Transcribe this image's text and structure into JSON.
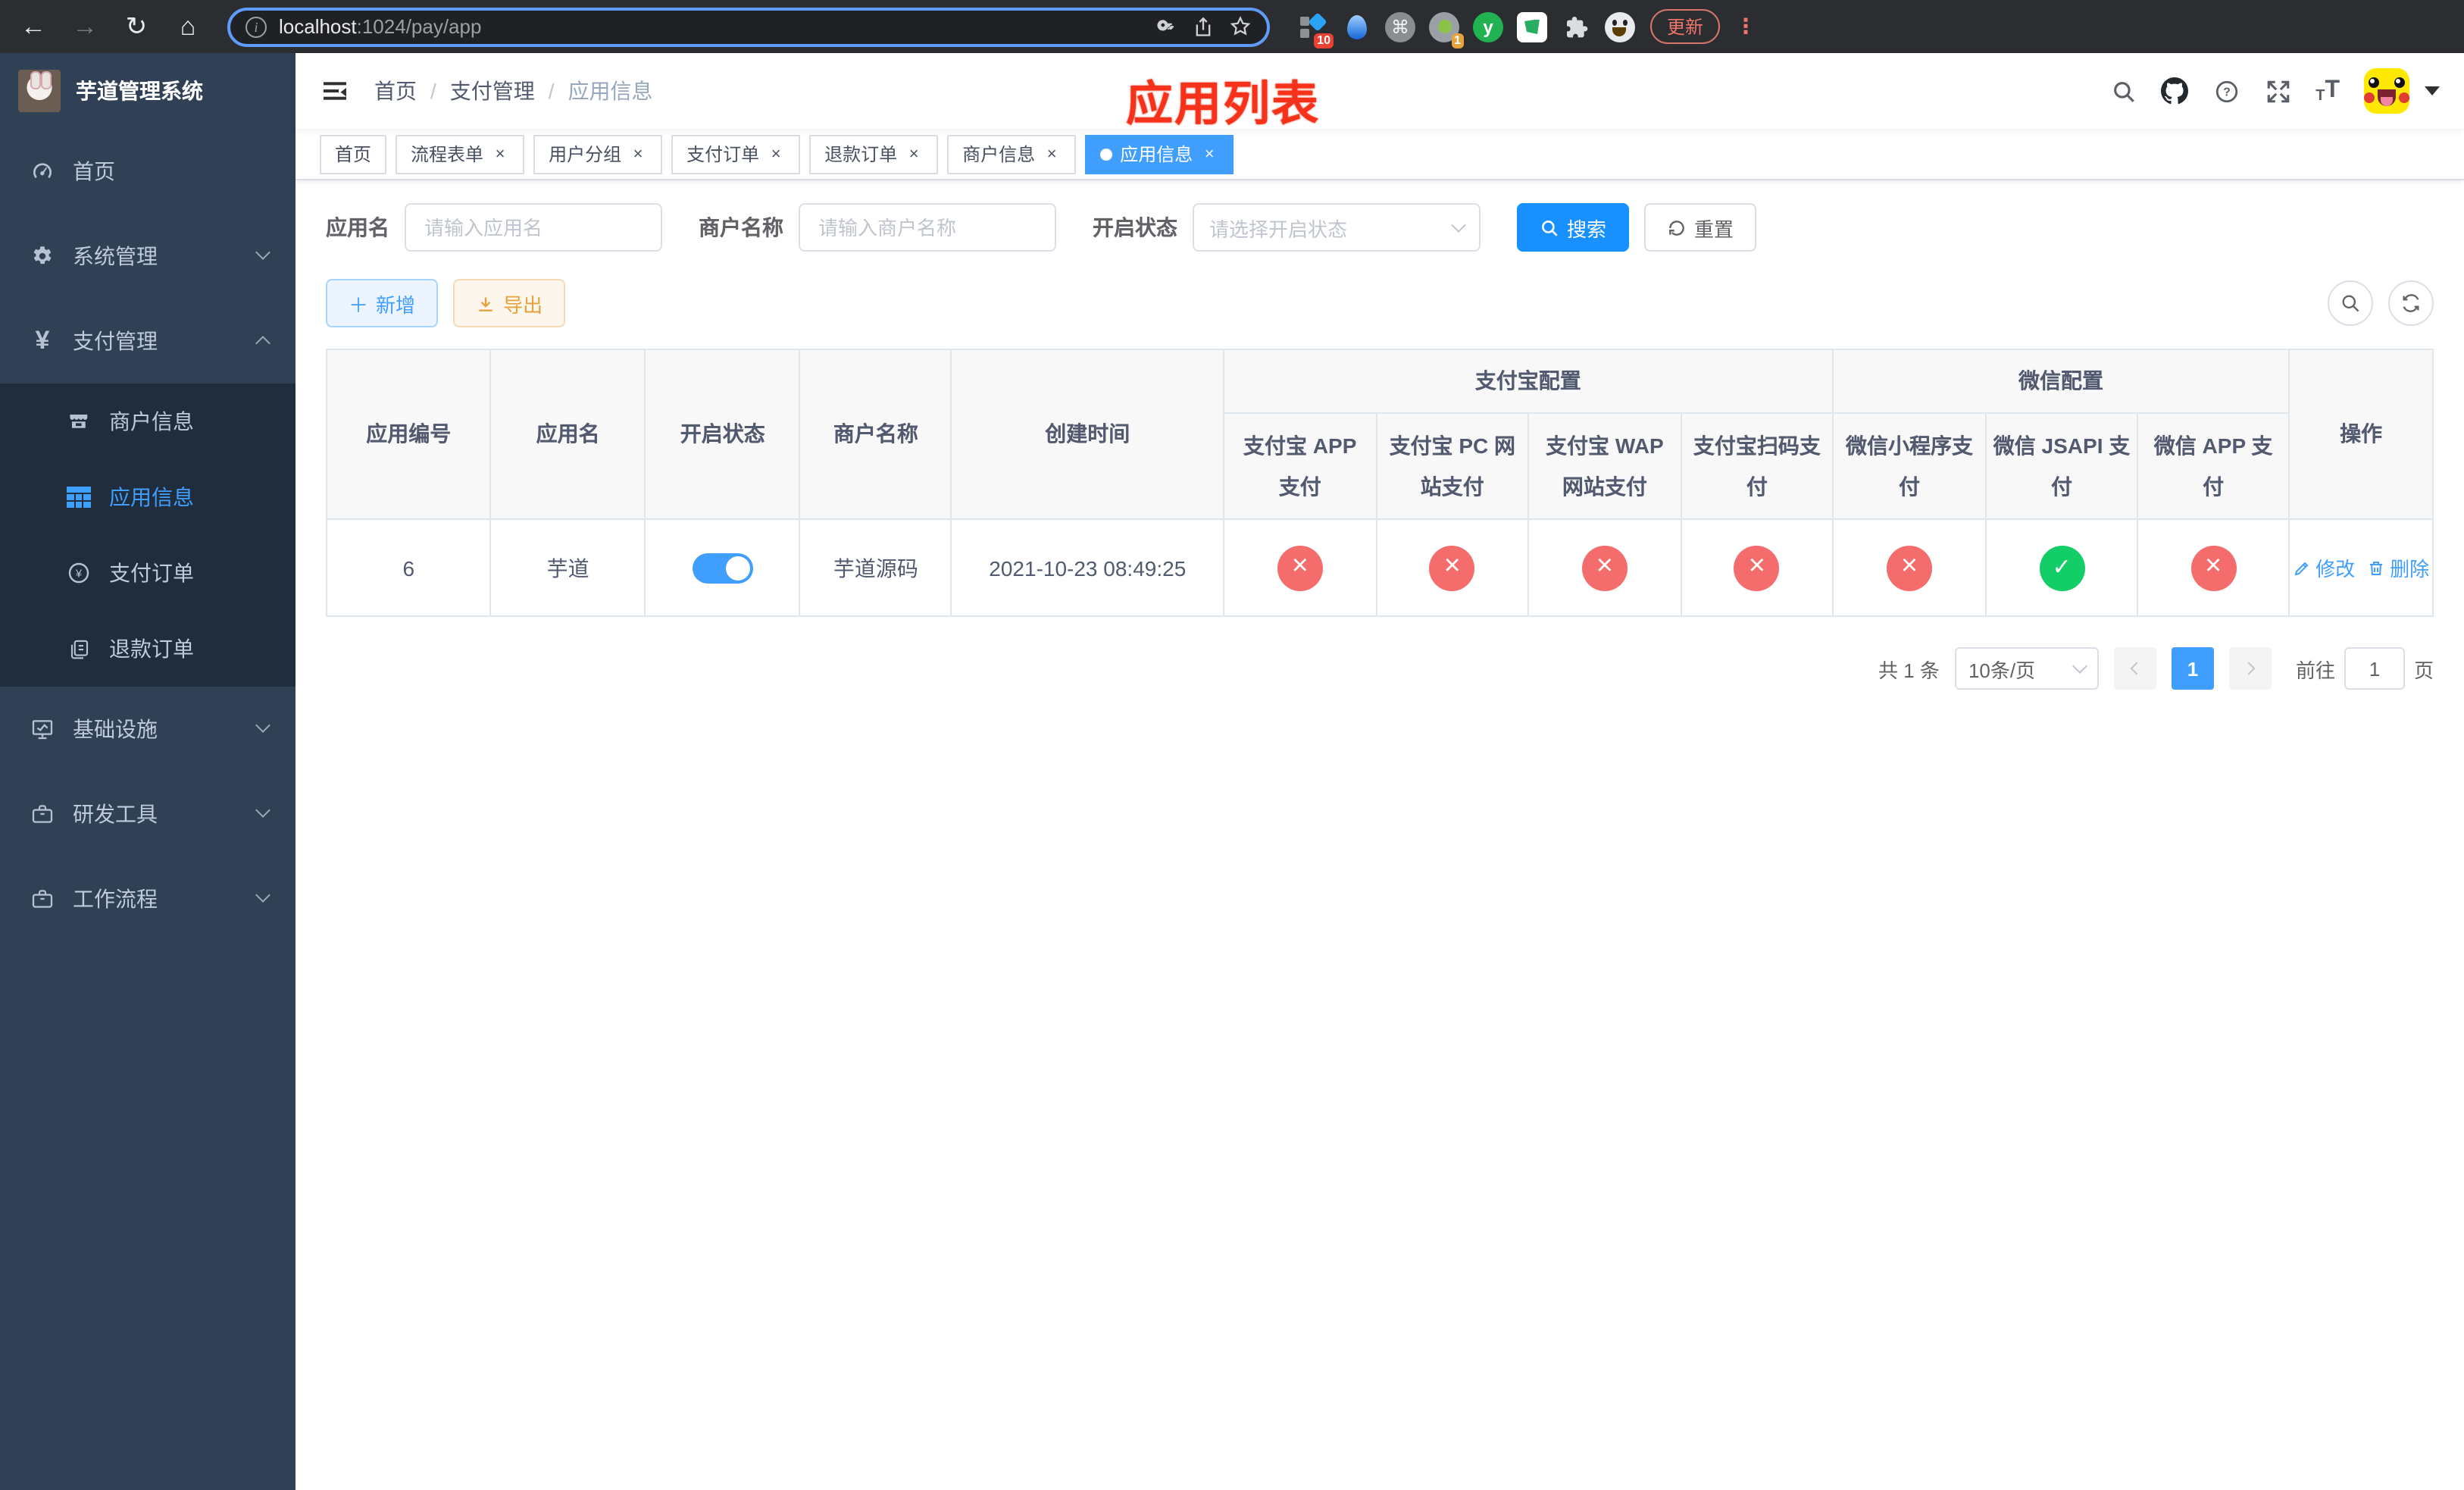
{
  "browser": {
    "url_host": "localhost",
    "url_path": ":1024/pay/app",
    "ext_badge_blocks": "10",
    "ext_badge_camera": "1",
    "update_label": "更新"
  },
  "sidebar": {
    "title": "芋道管理系统",
    "items": [
      {
        "label": "首页"
      },
      {
        "label": "系统管理"
      },
      {
        "label": "支付管理"
      },
      {
        "label": "商户信息"
      },
      {
        "label": "应用信息"
      },
      {
        "label": "支付订单"
      },
      {
        "label": "退款订单"
      },
      {
        "label": "基础设施"
      },
      {
        "label": "研发工具"
      },
      {
        "label": "工作流程"
      }
    ]
  },
  "header": {
    "breadcrumb": [
      "首页",
      "支付管理",
      "应用信息"
    ],
    "size_icon_text": "T"
  },
  "annotation": "应用列表",
  "tabs": [
    {
      "label": "首页"
    },
    {
      "label": "流程表单"
    },
    {
      "label": "用户分组"
    },
    {
      "label": "支付订单"
    },
    {
      "label": "退款订单"
    },
    {
      "label": "商户信息"
    },
    {
      "label": "应用信息"
    }
  ],
  "filters": {
    "app_name_label": "应用名",
    "app_name_placeholder": "请输入应用名",
    "merchant_label": "商户名称",
    "merchant_placeholder": "请输入商户名称",
    "status_label": "开启状态",
    "status_placeholder": "请选择开启状态",
    "search_label": "搜索",
    "reset_label": "重置"
  },
  "toolbar": {
    "add_label": "新增",
    "export_label": "导出"
  },
  "table": {
    "columns": [
      "应用编号",
      "应用名",
      "开启状态",
      "商户名称",
      "创建时间"
    ],
    "groups": [
      {
        "label": "支付宝配置",
        "children": [
          "支付宝 APP 支付",
          "支付宝 PC 网站支付",
          "支付宝 WAP 网站支付",
          "支付宝扫码支付"
        ]
      },
      {
        "label": "微信配置",
        "children": [
          "微信小程序支付",
          "微信 JSAPI 支付",
          "微信 APP 支付"
        ]
      }
    ],
    "action_col": "操作",
    "rows": [
      {
        "id": "6",
        "name": "芋道",
        "enabled": true,
        "merchant": "芋道源码",
        "created": "2021-10-23 08:49:25",
        "statuses": [
          "no",
          "no",
          "no",
          "no",
          "no",
          "yes",
          "no"
        ],
        "edit_label": "修改",
        "delete_label": "删除"
      }
    ]
  },
  "pagination": {
    "total": "共 1 条",
    "page_size": "10条/页",
    "current_page": "1",
    "goto_prefix": "前往",
    "goto_value": "1",
    "goto_suffix": "页"
  },
  "colors": {
    "accent": "#409eff",
    "success": "#13ce66",
    "danger": "#f56c6c",
    "warning": "#e6a23c",
    "annotation": "#f6321a",
    "sidebar_bg": "#304156",
    "submenu_bg": "#1f2d3d"
  }
}
